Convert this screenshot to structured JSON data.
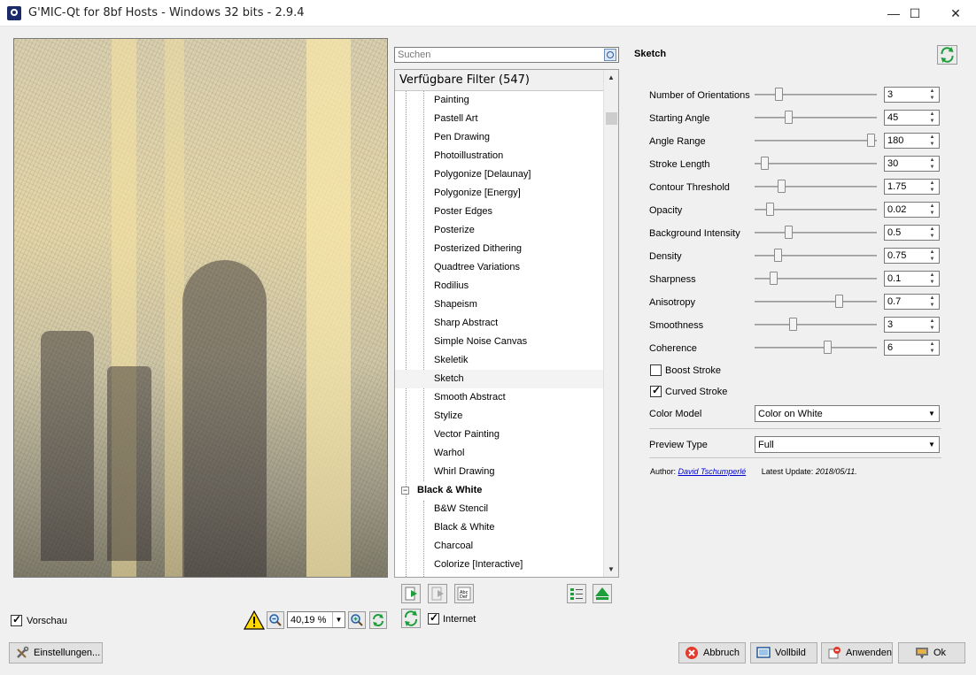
{
  "window": {
    "title": "G'MIC-Qt for 8bf Hosts - Windows 32 bits - 2.9.4",
    "minimize": "—",
    "maximize": "☐",
    "close": "✕"
  },
  "preview_panel": {
    "preview_checkbox_label": "Vorschau",
    "preview_checked": true,
    "zoom_value": "40,19 %"
  },
  "settings_button": "Einstellungen...",
  "filter_tree": {
    "search_placeholder": "Suchen",
    "header": "Verfügbare Filter (547)",
    "items": [
      {
        "label": "Painting",
        "type": "filter"
      },
      {
        "label": "Pastell Art",
        "type": "filter"
      },
      {
        "label": "Pen Drawing",
        "type": "filter"
      },
      {
        "label": "Photoillustration",
        "type": "filter"
      },
      {
        "label": "Polygonize [Delaunay]",
        "type": "filter"
      },
      {
        "label": "Polygonize [Energy]",
        "type": "filter"
      },
      {
        "label": "Poster Edges",
        "type": "filter"
      },
      {
        "label": "Posterize",
        "type": "filter"
      },
      {
        "label": "Posterized Dithering",
        "type": "filter"
      },
      {
        "label": "Quadtree Variations",
        "type": "filter"
      },
      {
        "label": "Rodilius",
        "type": "filter"
      },
      {
        "label": "Shapeism",
        "type": "filter"
      },
      {
        "label": "Sharp Abstract",
        "type": "filter"
      },
      {
        "label": "Simple Noise Canvas",
        "type": "filter"
      },
      {
        "label": "Skeletik",
        "type": "filter"
      },
      {
        "label": "Sketch",
        "type": "filter",
        "selected": true
      },
      {
        "label": "Smooth Abstract",
        "type": "filter"
      },
      {
        "label": "Stylize",
        "type": "filter"
      },
      {
        "label": "Vector Painting",
        "type": "filter"
      },
      {
        "label": "Warhol",
        "type": "filter"
      },
      {
        "label": "Whirl Drawing",
        "type": "filter"
      },
      {
        "label": "Black & White",
        "type": "category",
        "expander": "−"
      },
      {
        "label": "B&W Stencil",
        "type": "filter"
      },
      {
        "label": "Black & White",
        "type": "filter"
      },
      {
        "label": "Charcoal",
        "type": "filter"
      },
      {
        "label": "Colorize [Interactive]",
        "type": "filter"
      }
    ],
    "internet_label": "Internet",
    "internet_checked": true
  },
  "filter_settings": {
    "filter_name": "Sketch",
    "parameters": [
      {
        "label": "Number of Orientations",
        "value": "3",
        "position": 0.18
      },
      {
        "label": "Starting Angle",
        "value": "45",
        "position": 0.26
      },
      {
        "label": "Angle Range",
        "value": "180",
        "position": 0.98
      },
      {
        "label": "Stroke Length",
        "value": "30",
        "position": 0.05
      },
      {
        "label": "Contour Threshold",
        "value": "1.75",
        "position": 0.2
      },
      {
        "label": "Opacity",
        "value": "0.02",
        "position": 0.1
      },
      {
        "label": "Background Intensity",
        "value": "0.5",
        "position": 0.26
      },
      {
        "label": "Density",
        "value": "0.75",
        "position": 0.17
      },
      {
        "label": "Sharpness",
        "value": "0.1",
        "position": 0.13
      },
      {
        "label": "Anisotropy",
        "value": "0.7",
        "position": 0.7
      },
      {
        "label": "Smoothness",
        "value": "3",
        "position": 0.3
      },
      {
        "label": "Coherence",
        "value": "6",
        "position": 0.6
      }
    ],
    "boost_stroke_label": "Boost Stroke",
    "boost_stroke_checked": false,
    "curved_stroke_label": "Curved Stroke",
    "curved_stroke_checked": true,
    "color_model_label": "Color Model",
    "color_model_value": "Color on White",
    "preview_type_label": "Preview Type",
    "preview_type_value": "Full",
    "author_prefix": "Author:",
    "author_name": "David Tschumperlé",
    "update_prefix": "Latest Update:",
    "update_date": "2018/05/11."
  },
  "buttons": {
    "cancel": "Abbruch",
    "fullscreen": "Vollbild",
    "apply": "Anwenden",
    "ok": "Ok"
  },
  "colors": {
    "accent_green": "#1e9e3a",
    "link_blue": "#0000cc"
  }
}
